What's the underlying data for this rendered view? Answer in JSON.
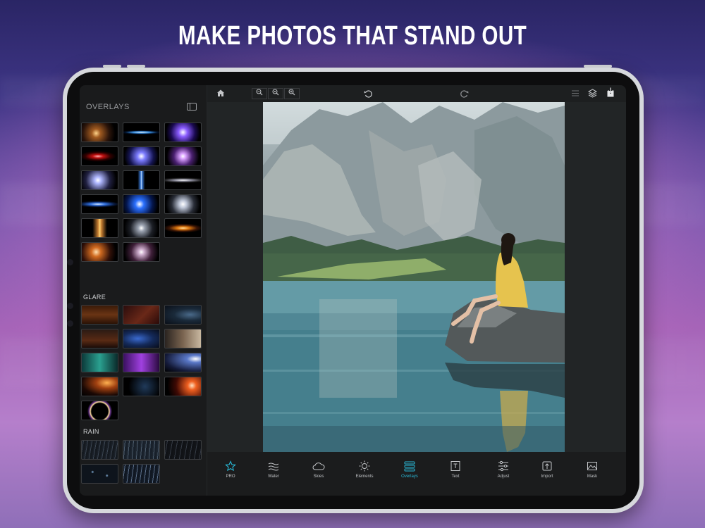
{
  "headline": "MAKE PHOTOS THAT STAND OUT",
  "sidebar": {
    "title": "OVERLAYS",
    "title_icon": "panel-toggle-icon",
    "sections": [
      {
        "label": "",
        "tiles": 17
      },
      {
        "label": "GLARE",
        "tiles": 13
      },
      {
        "label": "RAIN",
        "tiles": 5
      }
    ]
  },
  "toolbar": {
    "home_icon": "home-icon",
    "zoom_buttons": [
      "zoom-out-icon",
      "zoom-fit-icon",
      "zoom-in-icon"
    ],
    "undo_icon": "undo-icon",
    "redo_icon": "redo-icon",
    "right_icons": [
      "menu-icon",
      "layers-icon",
      "share-icon"
    ]
  },
  "bottom_bar": {
    "items": [
      {
        "label": "PRO",
        "icon": "star-icon",
        "active": false
      },
      {
        "label": "Water",
        "icon": "water-icon",
        "active": false
      },
      {
        "label": "Skies",
        "icon": "cloud-icon",
        "active": false
      },
      {
        "label": "Elements",
        "icon": "sun-icon",
        "active": false
      },
      {
        "label": "Overlays",
        "icon": "overlays-icon",
        "active": true
      },
      {
        "label": "Text",
        "icon": "text-icon",
        "active": false
      },
      {
        "label": "Adjust",
        "icon": "sliders-icon",
        "active": false
      },
      {
        "label": "Import",
        "icon": "import-icon",
        "active": false
      },
      {
        "label": "Mask",
        "icon": "mask-icon",
        "active": false
      }
    ]
  },
  "colors": {
    "accent": "#29b8d6",
    "panel": "#1a1b1c",
    "canvas": "#222526"
  }
}
